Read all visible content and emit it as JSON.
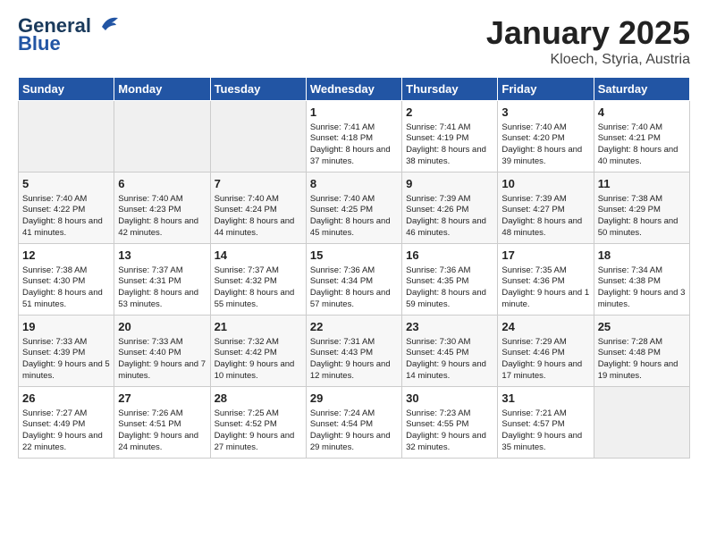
{
  "header": {
    "logo_general": "General",
    "logo_blue": "Blue",
    "month": "January 2025",
    "location": "Kloech, Styria, Austria"
  },
  "weekdays": [
    "Sunday",
    "Monday",
    "Tuesday",
    "Wednesday",
    "Thursday",
    "Friday",
    "Saturday"
  ],
  "weeks": [
    [
      {
        "day": "",
        "empty": true
      },
      {
        "day": "",
        "empty": true
      },
      {
        "day": "",
        "empty": true
      },
      {
        "day": "1",
        "sunrise": "7:41 AM",
        "sunset": "4:18 PM",
        "daylight": "8 hours and 37 minutes."
      },
      {
        "day": "2",
        "sunrise": "7:41 AM",
        "sunset": "4:19 PM",
        "daylight": "8 hours and 38 minutes."
      },
      {
        "day": "3",
        "sunrise": "7:40 AM",
        "sunset": "4:20 PM",
        "daylight": "8 hours and 39 minutes."
      },
      {
        "day": "4",
        "sunrise": "7:40 AM",
        "sunset": "4:21 PM",
        "daylight": "8 hours and 40 minutes."
      }
    ],
    [
      {
        "day": "5",
        "sunrise": "7:40 AM",
        "sunset": "4:22 PM",
        "daylight": "8 hours and 41 minutes."
      },
      {
        "day": "6",
        "sunrise": "7:40 AM",
        "sunset": "4:23 PM",
        "daylight": "8 hours and 42 minutes."
      },
      {
        "day": "7",
        "sunrise": "7:40 AM",
        "sunset": "4:24 PM",
        "daylight": "8 hours and 44 minutes."
      },
      {
        "day": "8",
        "sunrise": "7:40 AM",
        "sunset": "4:25 PM",
        "daylight": "8 hours and 45 minutes."
      },
      {
        "day": "9",
        "sunrise": "7:39 AM",
        "sunset": "4:26 PM",
        "daylight": "8 hours and 46 minutes."
      },
      {
        "day": "10",
        "sunrise": "7:39 AM",
        "sunset": "4:27 PM",
        "daylight": "8 hours and 48 minutes."
      },
      {
        "day": "11",
        "sunrise": "7:38 AM",
        "sunset": "4:29 PM",
        "daylight": "8 hours and 50 minutes."
      }
    ],
    [
      {
        "day": "12",
        "sunrise": "7:38 AM",
        "sunset": "4:30 PM",
        "daylight": "8 hours and 51 minutes."
      },
      {
        "day": "13",
        "sunrise": "7:37 AM",
        "sunset": "4:31 PM",
        "daylight": "8 hours and 53 minutes."
      },
      {
        "day": "14",
        "sunrise": "7:37 AM",
        "sunset": "4:32 PM",
        "daylight": "8 hours and 55 minutes."
      },
      {
        "day": "15",
        "sunrise": "7:36 AM",
        "sunset": "4:34 PM",
        "daylight": "8 hours and 57 minutes."
      },
      {
        "day": "16",
        "sunrise": "7:36 AM",
        "sunset": "4:35 PM",
        "daylight": "8 hours and 59 minutes."
      },
      {
        "day": "17",
        "sunrise": "7:35 AM",
        "sunset": "4:36 PM",
        "daylight": "9 hours and 1 minute."
      },
      {
        "day": "18",
        "sunrise": "7:34 AM",
        "sunset": "4:38 PM",
        "daylight": "9 hours and 3 minutes."
      }
    ],
    [
      {
        "day": "19",
        "sunrise": "7:33 AM",
        "sunset": "4:39 PM",
        "daylight": "9 hours and 5 minutes."
      },
      {
        "day": "20",
        "sunrise": "7:33 AM",
        "sunset": "4:40 PM",
        "daylight": "9 hours and 7 minutes."
      },
      {
        "day": "21",
        "sunrise": "7:32 AM",
        "sunset": "4:42 PM",
        "daylight": "9 hours and 10 minutes."
      },
      {
        "day": "22",
        "sunrise": "7:31 AM",
        "sunset": "4:43 PM",
        "daylight": "9 hours and 12 minutes."
      },
      {
        "day": "23",
        "sunrise": "7:30 AM",
        "sunset": "4:45 PM",
        "daylight": "9 hours and 14 minutes."
      },
      {
        "day": "24",
        "sunrise": "7:29 AM",
        "sunset": "4:46 PM",
        "daylight": "9 hours and 17 minutes."
      },
      {
        "day": "25",
        "sunrise": "7:28 AM",
        "sunset": "4:48 PM",
        "daylight": "9 hours and 19 minutes."
      }
    ],
    [
      {
        "day": "26",
        "sunrise": "7:27 AM",
        "sunset": "4:49 PM",
        "daylight": "9 hours and 22 minutes."
      },
      {
        "day": "27",
        "sunrise": "7:26 AM",
        "sunset": "4:51 PM",
        "daylight": "9 hours and 24 minutes."
      },
      {
        "day": "28",
        "sunrise": "7:25 AM",
        "sunset": "4:52 PM",
        "daylight": "9 hours and 27 minutes."
      },
      {
        "day": "29",
        "sunrise": "7:24 AM",
        "sunset": "4:54 PM",
        "daylight": "9 hours and 29 minutes."
      },
      {
        "day": "30",
        "sunrise": "7:23 AM",
        "sunset": "4:55 PM",
        "daylight": "9 hours and 32 minutes."
      },
      {
        "day": "31",
        "sunrise": "7:21 AM",
        "sunset": "4:57 PM",
        "daylight": "9 hours and 35 minutes."
      },
      {
        "day": "",
        "empty": true
      }
    ]
  ]
}
